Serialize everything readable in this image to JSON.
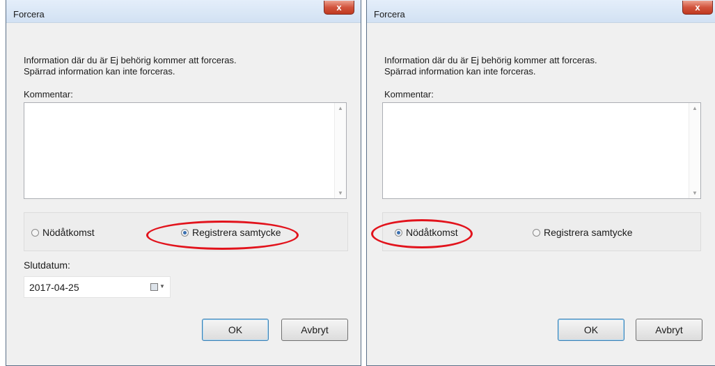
{
  "dialogs": [
    {
      "title": "Forcera",
      "close_label": "x",
      "info_line1": "Information där du är Ej behörig kommer att forceras.",
      "info_line2": "Spärrad information kan inte forceras.",
      "comment_label": "Kommentar:",
      "comment_value": "",
      "radios": [
        {
          "label": "Nödåtkomst",
          "checked": false
        },
        {
          "label": "Registrera samtycke",
          "checked": true
        }
      ],
      "end_date_label": "Slutdatum:",
      "end_date_value": "2017-04-25",
      "ok_label": "OK",
      "cancel_label": "Avbryt"
    },
    {
      "title": "Forcera",
      "close_label": "x",
      "info_line1": "Information där du är Ej behörig kommer att forceras.",
      "info_line2": "Spärrad information kan inte forceras.",
      "comment_label": "Kommentar:",
      "comment_value": "",
      "radios": [
        {
          "label": "Nödåtkomst",
          "checked": true
        },
        {
          "label": "Registrera samtycke",
          "checked": false
        }
      ],
      "ok_label": "OK",
      "cancel_label": "Avbryt"
    }
  ],
  "colors": {
    "highlight": "#e2131c",
    "close_button": "#c8442a",
    "dialog_bg": "#f0f0f0",
    "radio_selected": "#3a6fb0"
  },
  "icons": {
    "close": "close-icon",
    "scroll_up": "scroll-up-arrow-icon",
    "scroll_down": "scroll-down-arrow-icon",
    "calendar": "calendar-icon",
    "dropdown": "chevron-down-icon"
  }
}
